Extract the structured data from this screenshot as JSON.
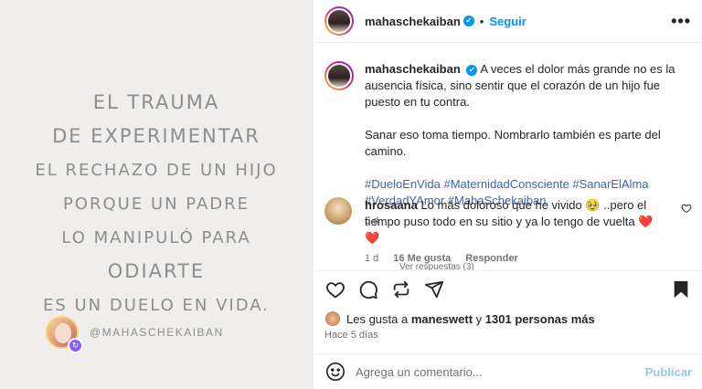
{
  "image": {
    "quote_lines": [
      "EL TRAUMA",
      "DE EXPERIMENTAR",
      "EL RECHAZO DE UN HIJO",
      "PORQUE UN PADRE",
      "LO MANIPULÓ PARA",
      "ODIARTE",
      "ES UN DUELO EN VIDA."
    ],
    "handle": "@MAHASCHEKAIBAN"
  },
  "header": {
    "username": "mahaschekaiban",
    "verified_icon": "✔",
    "dot": "•",
    "follow_label": "Seguir",
    "more_icon": "•••"
  },
  "caption": {
    "username": "mahaschekaiban",
    "verified_icon": "✔",
    "text1": "A veces el dolor más grande no es la ausencia física, sino sentir que el corazón de un hijo fue puesto en tu contra.",
    "text2": "Sanar eso toma tiempo. Nombrarlo también es parte del camino.",
    "hashtags": "#DueloEnVida #MaternidadConsciente #SanarElAlma #VerdadYAmor #MahaSchekaiban",
    "time": "5 d"
  },
  "comment": {
    "username": "hrosaana",
    "text": "Lo más doloroso que he vivido 🥹 ..pero el tiempo puso todo en su sitio y ya lo tengo de vuelta",
    "hearts": "❤️ ❤️",
    "time": "1 d",
    "likes": "16 Me gusta",
    "reply": "Responder",
    "view_replies": "Ver respuestas (3)"
  },
  "likes": {
    "prefix": "Les gusta a",
    "user": "maneswett",
    "middle": "y",
    "count": "1301 personas más"
  },
  "posted": "Hace 5 días",
  "composer": {
    "placeholder": "Agrega un comentario...",
    "publish": "Publicar"
  }
}
